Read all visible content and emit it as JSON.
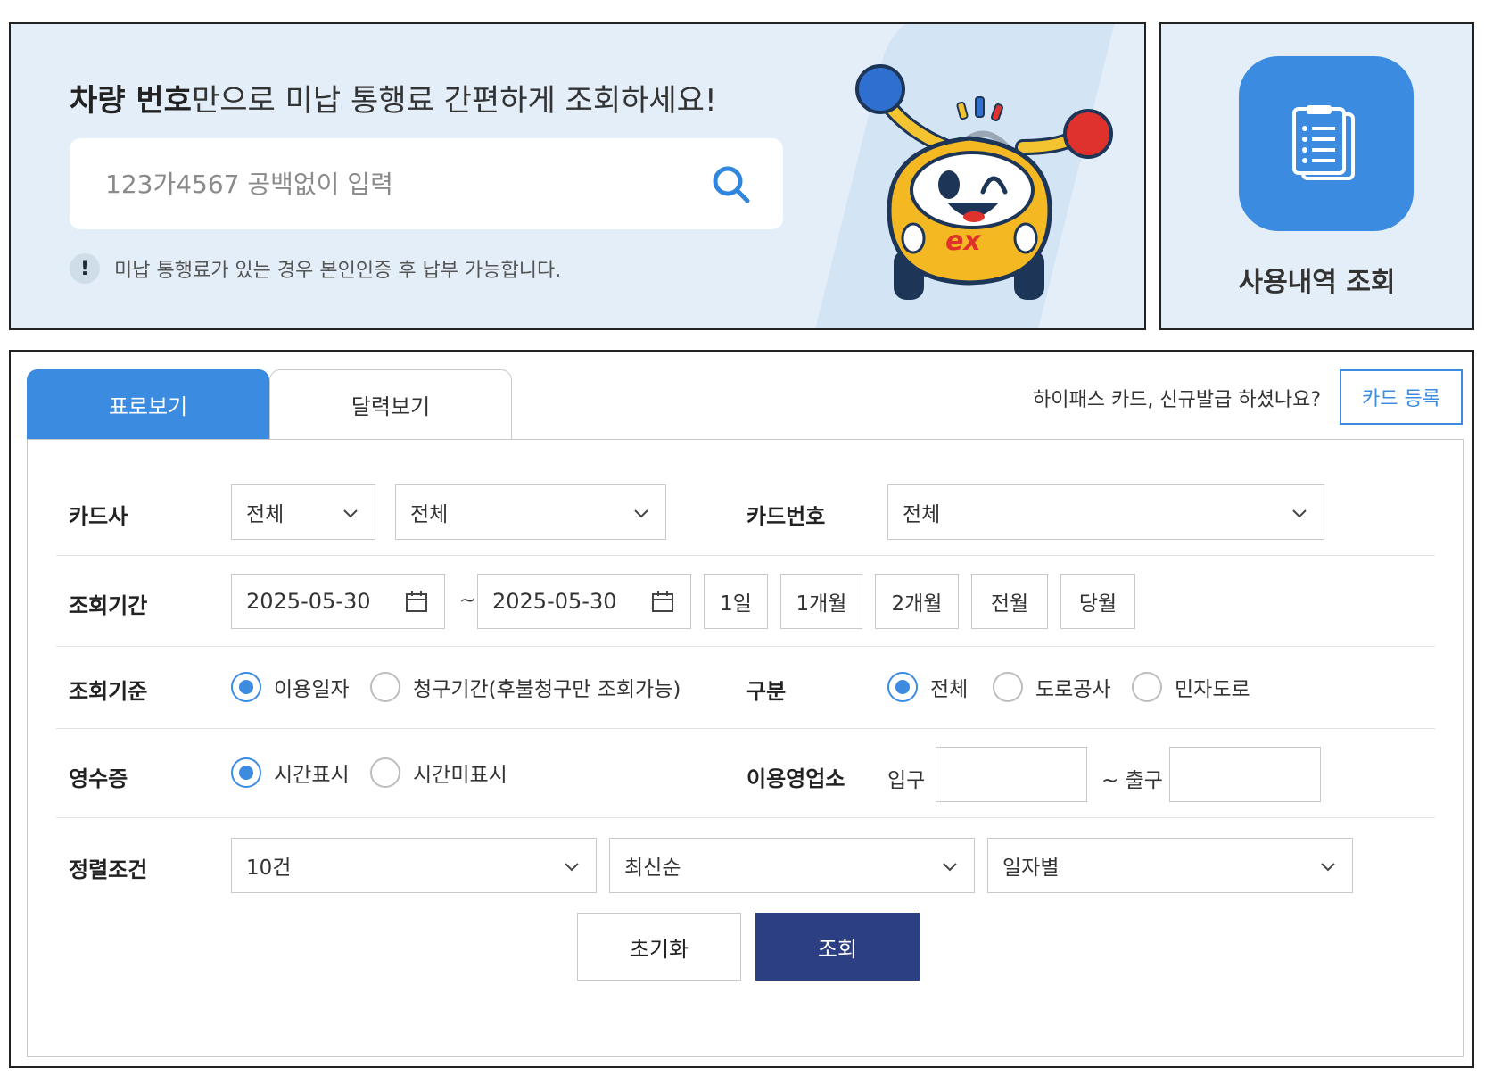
{
  "banner": {
    "title_bold": "차량 번호",
    "title_rest": "만으로 미납 통행료 간편하게 조회하세요!",
    "search_placeholder": "123가4567 공백없이 입력",
    "notice_icon": "!",
    "notice_text": "미납 통행료가 있는 경우 본인인증 후 납부 가능합니다.",
    "mascot_logo": "ex"
  },
  "usage_tile": {
    "label": "사용내역 조회",
    "icon": "document-list-icon"
  },
  "tabs": [
    {
      "label": "표로보기",
      "active": true
    },
    {
      "label": "달력보기",
      "active": false
    }
  ],
  "card_prompt": {
    "question": "하이패스 카드, 신규발급 하셨나요?",
    "button": "카드 등록"
  },
  "form": {
    "card_company": {
      "label": "카드사",
      "select1": "전체",
      "select2": "전체"
    },
    "card_number": {
      "label": "카드번호",
      "value": "전체"
    },
    "period": {
      "label": "조회기간",
      "start": "2025-05-30",
      "separator": "~",
      "end": "2025-05-30",
      "quick": [
        "1일",
        "1개월",
        "2개월",
        "전월",
        "당월"
      ]
    },
    "criteria": {
      "label": "조회기준",
      "options": [
        "이용일자",
        "청구기간(후불청구만 조회가능)"
      ],
      "selected": 0
    },
    "category": {
      "label": "구분",
      "options": [
        "전체",
        "도로공사",
        "민자도로"
      ],
      "selected": 0
    },
    "receipt": {
      "label": "영수증",
      "options": [
        "시간표시",
        "시간미표시"
      ],
      "selected": 0
    },
    "office": {
      "label": "이용영업소",
      "entry_label": "입구",
      "exit_label": "~ 출구",
      "entry_value": "",
      "exit_value": ""
    },
    "sort": {
      "label": "정렬조건",
      "count": "10건",
      "order": "최신순",
      "group": "일자별"
    }
  },
  "actions": {
    "reset": "초기화",
    "search": "조회"
  },
  "colors": {
    "accent": "#3b8be0",
    "primary_button": "#2b3f82",
    "banner_bg": "#e3eef8"
  }
}
